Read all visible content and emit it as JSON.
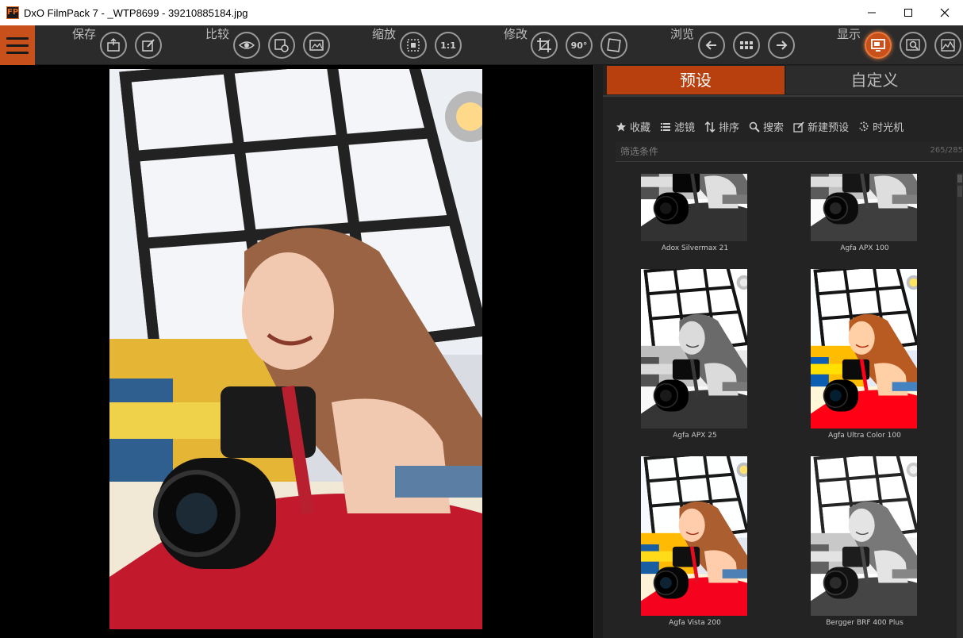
{
  "window": {
    "title": "DxO FilmPack 7 - _WTP8699 - 39210885184.jpg",
    "icon_text": "FP"
  },
  "toolbar": {
    "groups": {
      "save": "保存",
      "compare": "比较",
      "zoom": "缩放",
      "modify": "修改",
      "browse": "浏览",
      "display": "显示"
    },
    "zoom_1to1": "1:1",
    "rotate_90": "90°"
  },
  "panel": {
    "tabs": {
      "presets": "预设",
      "custom": "自定义"
    },
    "tools": {
      "favorites": "收藏",
      "filters": "滤镜",
      "sort": "排序",
      "search": "搜索",
      "new_preset": "新建预设",
      "time_machine": "时光机"
    },
    "filter": {
      "placeholder": "筛选条件",
      "count": "265/285"
    },
    "presets": [
      {
        "name": "Adox Silvermax 21",
        "style": "bw"
      },
      {
        "name": "Agfa APX 100",
        "style": "bw"
      },
      {
        "name": "Agfa APX 25",
        "style": "bw"
      },
      {
        "name": "Agfa Ultra Color 100",
        "style": "color"
      },
      {
        "name": "Agfa Vista 200",
        "style": "color"
      },
      {
        "name": "Bergger BRF 400 Plus",
        "style": "bw"
      }
    ]
  },
  "colors": {
    "accent": "#c8501a",
    "tab_active": "#b8400f",
    "toolbar_bg": "#2b2b2b",
    "panel_bg": "#232323"
  }
}
